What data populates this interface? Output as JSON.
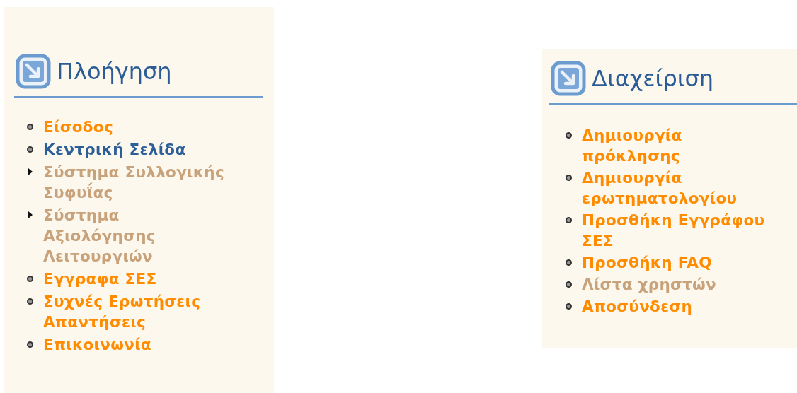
{
  "panels": [
    {
      "title": "Πλοήγηση",
      "items": [
        {
          "label": "Είσοδος",
          "kind": "bullet",
          "selected": false,
          "disabled": false
        },
        {
          "label": "Κεντρική Σελίδα",
          "kind": "bullet",
          "selected": true,
          "disabled": false
        },
        {
          "label": "Σύστημα Συλλογικής Συφυΐας",
          "kind": "submenu",
          "selected": false,
          "disabled": true
        },
        {
          "label": "Σύστημα Αξιολόγησης Λειτουργιών",
          "kind": "submenu",
          "selected": false,
          "disabled": true
        },
        {
          "label": "Εγγραφα ΣΕΣ",
          "kind": "bullet",
          "selected": false,
          "disabled": false
        },
        {
          "label": "Συχνές Ερωτήσεις Απαντήσεις",
          "kind": "bullet",
          "selected": false,
          "disabled": false
        },
        {
          "label": "Επικοινωνία",
          "kind": "bullet",
          "selected": false,
          "disabled": false
        }
      ]
    },
    {
      "title": "Διαχείριση",
      "items": [
        {
          "label": "Δημιουργία πρόκλησης",
          "kind": "bullet",
          "selected": false,
          "disabled": false
        },
        {
          "label": "Δημιουργία ερωτηματολογίου",
          "kind": "bullet",
          "selected": false,
          "disabled": false
        },
        {
          "label": "Προσθήκη Εγγράφου ΣΕΣ",
          "kind": "bullet",
          "selected": false,
          "disabled": false
        },
        {
          "label": "Προσθήκη FAQ",
          "kind": "bullet",
          "selected": false,
          "disabled": false
        },
        {
          "label": "Λίστα χρηστών",
          "kind": "bullet",
          "selected": false,
          "disabled": true
        },
        {
          "label": "Αποσύνδεση",
          "kind": "bullet",
          "selected": false,
          "disabled": false
        }
      ]
    }
  ]
}
